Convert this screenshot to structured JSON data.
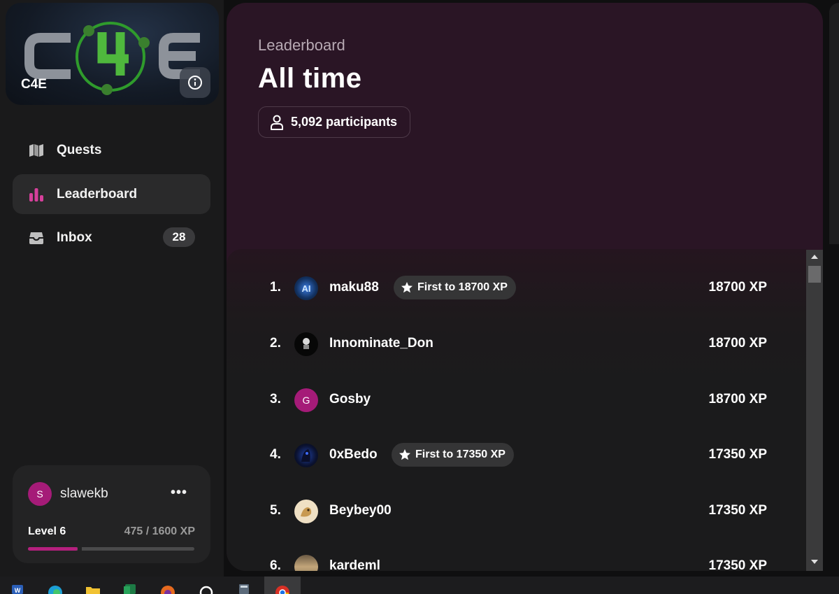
{
  "brand": {
    "name": "C4E",
    "logo_text": "C4E"
  },
  "nav": {
    "items": [
      {
        "label": "Quests",
        "icon": "map-icon"
      },
      {
        "label": "Leaderboard",
        "icon": "bar-chart-icon"
      },
      {
        "label": "Inbox",
        "icon": "inbox-icon",
        "badge": "28"
      }
    ]
  },
  "user": {
    "initial": "S",
    "name": "slawekb",
    "menu": "•••",
    "level": "Level 6",
    "xp": "475 / 1600 XP",
    "progress": 0.297
  },
  "header": {
    "subtitle": "Leaderboard",
    "title": "All time",
    "participants": "5,092 participants"
  },
  "leaderboard": [
    {
      "rank": "1.",
      "name": "maku88",
      "badge": "First to 18700 XP",
      "score": "18700 XP"
    },
    {
      "rank": "2.",
      "name": "Innominate_Don",
      "badge": "",
      "score": "18700 XP"
    },
    {
      "rank": "3.",
      "name": "Gosby",
      "initial": "G",
      "badge": "",
      "score": "18700 XP"
    },
    {
      "rank": "4.",
      "name": "0xBedo",
      "badge": "First to 17350 XP",
      "score": "17350 XP"
    },
    {
      "rank": "5.",
      "name": "Beybey00",
      "badge": "",
      "score": "17350 XP"
    },
    {
      "rank": "6.",
      "name": "kardeml",
      "badge": "",
      "score": "17350 XP"
    }
  ],
  "colors": {
    "accent": "#b5207e",
    "header_bg": "#2a1525",
    "sidebar_bg": "#1a1a1b"
  }
}
